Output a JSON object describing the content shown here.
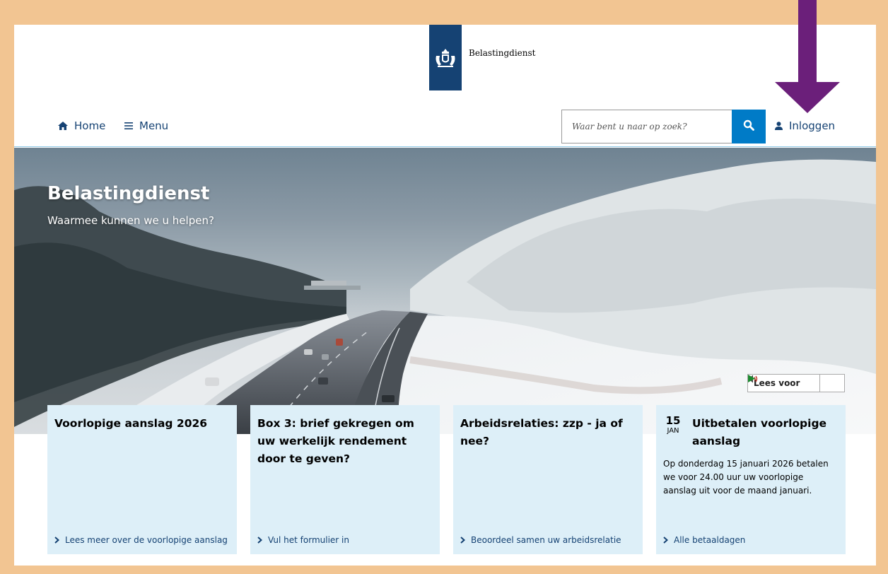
{
  "header": {
    "logo_text": "Belastingdienst"
  },
  "nav": {
    "home_label": "Home",
    "menu_label": "Menu",
    "search_placeholder": "Waar bent u naar op zoek?",
    "login_label": "Inloggen"
  },
  "hero": {
    "title": "Belastingdienst",
    "subtitle": "Waarmee kunnen we u helpen?",
    "readspeaker_label": "Lees voor"
  },
  "cards": [
    {
      "title": "Voorlopige aanslag 2026",
      "link": "Lees meer over de voorlopige aanslag"
    },
    {
      "title": "Box 3: brief gekregen om uw werkelijk rendement door te geven?",
      "link": "Vul het formulier in"
    },
    {
      "title": "Arbeidsrelaties: zzp - ja of nee?",
      "link": "Beoordeel samen uw arbeidsrelatie"
    },
    {
      "date_day": "15",
      "date_month": "JAN",
      "title": "Uitbetalen voorlopige aanslag",
      "body": "Op donderdag 15 januari 2026 betalen we voor 24.00 uur uw voorlopige aanslag uit voor de maand januari.",
      "link": "Alle betaaldagen"
    }
  ],
  "colors": {
    "brand_blue": "#154273",
    "search_button": "#007bc7",
    "card_background": "#ddeff8",
    "frame": "#f2c592",
    "annotation_arrow": "#6b1f7a"
  }
}
